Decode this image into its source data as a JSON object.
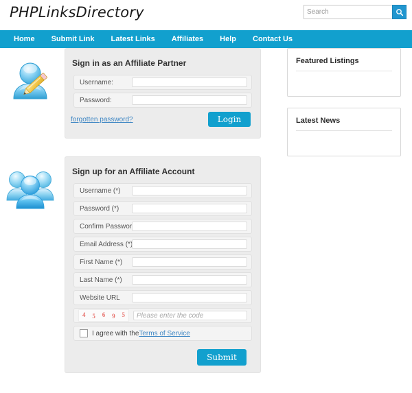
{
  "header": {
    "logo": "PHPLinksDirectory",
    "search": {
      "placeholder": "Search",
      "value": "",
      "button_icon": "search-icon"
    }
  },
  "nav": {
    "items": [
      {
        "label": "Home"
      },
      {
        "label": "Submit Link"
      },
      {
        "label": "Latest Links"
      },
      {
        "label": "Affiliates"
      },
      {
        "label": "Help"
      },
      {
        "label": "Contact Us"
      }
    ]
  },
  "login_panel": {
    "icon": "user-edit-icon",
    "title": "Sign in as an Affiliate Partner",
    "fields": [
      {
        "label": "Username:",
        "value": "",
        "placeholder": ""
      },
      {
        "label": "Password:",
        "value": "",
        "placeholder": ""
      }
    ],
    "forgot_label": "forgotten password?",
    "submit_label": "Login"
  },
  "signup_panel": {
    "icon": "users-group-icon",
    "title": "Sign up for an Affiliate Account",
    "fields": [
      {
        "label": "Username (*)",
        "value": "",
        "placeholder": ""
      },
      {
        "label": "Password (*)",
        "value": "",
        "placeholder": ""
      },
      {
        "label": "Confirm Password",
        "value": "",
        "placeholder": ""
      },
      {
        "label": "Email Address (*)",
        "value": "",
        "placeholder": ""
      },
      {
        "label": "First Name (*)",
        "value": "",
        "placeholder": ""
      },
      {
        "label": "Last Name (*)",
        "value": "",
        "placeholder": ""
      },
      {
        "label": "Website URL",
        "value": "",
        "placeholder": ""
      }
    ],
    "captcha": {
      "digits": [
        "4",
        "5",
        "6",
        "9",
        "5"
      ],
      "placeholder": "Please enter the code",
      "value": ""
    },
    "agreement": {
      "checked": false,
      "text": "I agree with the ",
      "link_label": "Terms of Service"
    },
    "submit_label": "Submit"
  },
  "sidebar": {
    "widgets": [
      {
        "title": "Featured Listings"
      },
      {
        "title": "Latest News"
      }
    ]
  },
  "colors": {
    "accent": "#12a0ce",
    "link": "#3f87c4",
    "panel_bg": "#ececec",
    "captcha_text": "#e8736e"
  }
}
